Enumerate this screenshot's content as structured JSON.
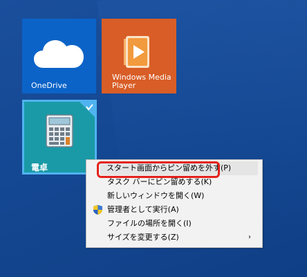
{
  "tiles": [
    {
      "label": "OneDrive"
    },
    {
      "label": "Windows Media\nPlayer"
    },
    {
      "label": "電卓",
      "selected": true
    }
  ],
  "context_menu": {
    "items": [
      {
        "label": "スタート画面からピン留めを外す(P)",
        "highlighted": true
      },
      {
        "label": "タスク バーにピン留めする(K)"
      },
      {
        "label": "新しいウィンドウを開く(W)"
      },
      {
        "label": "管理者として実行(A)",
        "icon": "uac-shield-icon"
      },
      {
        "label": "ファイルの場所を開く(I)"
      },
      {
        "label": "サイズを変更する(Z)",
        "submenu": true,
        "arrow": "›"
      }
    ]
  },
  "colors": {
    "desktop_background": "#154893",
    "onedrive_tile": "#0b63c8",
    "wmp_tile": "#d85d26",
    "calc_tile": "#1a9aa6",
    "selection_border": "#4fb3f0",
    "callout": "#e4211b"
  }
}
